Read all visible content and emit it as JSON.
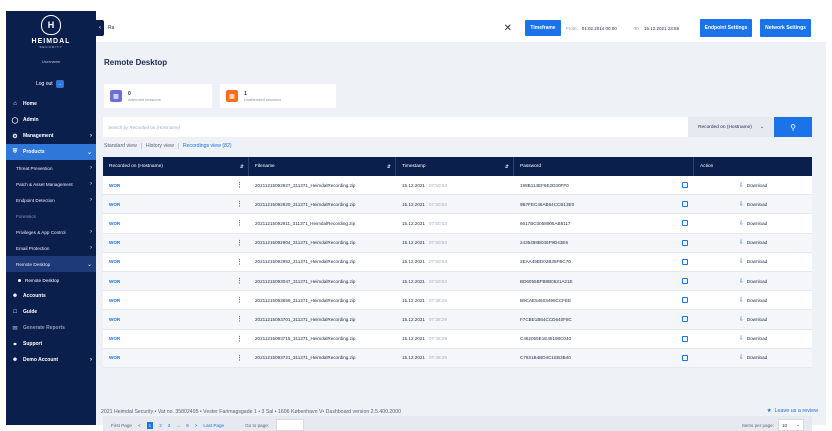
{
  "brand": {
    "name": "HEIMDAL",
    "tagline": "SECURITY",
    "user": "Username"
  },
  "logout": {
    "label": "Log out"
  },
  "sidebar": {
    "items": [
      {
        "label": "Home",
        "icon": "home-icon"
      },
      {
        "label": "Admin",
        "icon": "admin-icon"
      },
      {
        "label": "Management",
        "icon": "management-icon"
      },
      {
        "label": "Products",
        "icon": "shield-icon"
      }
    ],
    "products_sub": [
      "Threat Prevention",
      "Patch & Asset Management",
      "Endpoint Detection",
      "Forensics",
      "Privileges & App Control",
      "Email Protection",
      "Remote Desktop"
    ],
    "remote_sub": "Remote Desktop",
    "bottom_items": [
      {
        "label": "Accounts",
        "icon": "accounts-icon"
      },
      {
        "label": "Guide",
        "icon": "guide-icon"
      },
      {
        "label": "Generate Reports",
        "icon": "reports-icon"
      },
      {
        "label": "Support",
        "icon": "support-icon"
      },
      {
        "label": "Demo Account",
        "icon": "demo-account-icon"
      }
    ]
  },
  "topbar": {
    "search_value": "Ra",
    "timeframe_label": "Timeframe",
    "from_label": "From:",
    "from_value": "01.02.2014 00:00",
    "to_label": "To:",
    "to_value": "15.12.2021 23:59",
    "endpoint_settings": "Endpoint Settings",
    "network_settings": "Network Settings"
  },
  "page": {
    "title": "Remote Desktop",
    "attended": {
      "count": "0",
      "label": "Attended sessions"
    },
    "unattended": {
      "count": "1",
      "label": "Unattended sessions"
    },
    "search_placeholder": "Search by Recorded on (Hostname)",
    "filter_select": "Recorded on (Hostname)",
    "views": [
      "Standard view",
      "History view",
      "Recordings view (82)"
    ]
  },
  "table": {
    "headers": [
      "Recorded on (Hostname)",
      "Filename",
      "Timestamp",
      "Password",
      "Action"
    ],
    "rows": [
      {
        "host": "WOR",
        "file": "20211215092927_311371_HeimdalRecording.zip",
        "date": "15.12.2021",
        "time": "07:50:53",
        "pwd": "198B114EF6E2D30FF0",
        "action": "Download"
      },
      {
        "host": "WOR",
        "file": "20211215092920_311371_HeimdalRecording.zip",
        "date": "15.12.2021",
        "time": "07:50:53",
        "pwd": "9B7FEC46AB64CCB13E0",
        "action": "Download"
      },
      {
        "host": "WOR",
        "file": "20211215092911_311371_HeimdalRecording.zip",
        "date": "15.12.2021",
        "time": "07:50:53",
        "pwd": "6617BC0058905AB8117",
        "action": "Download"
      },
      {
        "host": "WOR",
        "file": "20211215092904_311371_HeimdalRecording.zip",
        "date": "15.12.2021",
        "time": "07:50:53",
        "pwd": "2435498B046F9D43E6",
        "action": "Download"
      },
      {
        "host": "WOR",
        "file": "20211215092952_311371_HeimdalRecording.zip",
        "date": "15.12.2021",
        "time": "07:50:53",
        "pwd": "2EAA49BD02B35FBC70",
        "action": "Download"
      },
      {
        "host": "WOR",
        "file": "20211215093047_311371_HeimdalRecording.zip",
        "date": "15.12.2021",
        "time": "07:50:53",
        "pwd": "BD6055BFB8B0531A21E",
        "action": "Download"
      },
      {
        "host": "WOR",
        "file": "20211215093659_311371_HeimdalRecording.zip",
        "date": "15.12.2021",
        "time": "07:38:29",
        "pwd": "B9CAE54603498CCFEE",
        "action": "Download"
      },
      {
        "host": "WOR",
        "file": "20211215093701_311371_HeimdalRecording.zip",
        "date": "15.12.2021",
        "time": "07:38:29",
        "pwd": "F7CBE1B64CCD640F8C",
        "action": "Download"
      },
      {
        "host": "WOR",
        "file": "20211215093715_311371_HeimdalRecording.zip",
        "date": "15.12.2021",
        "time": "07:38:29",
        "pwd": "C462055E1E45198C040",
        "action": "Download"
      },
      {
        "host": "WOR",
        "file": "20211215093721_311371_HeimdalRecording.zip",
        "date": "15.12.2021",
        "time": "07:38:29",
        "pwd": "C7831B4BD4C1EB3B40",
        "action": "Download"
      }
    ]
  },
  "pager": {
    "first": "First Page",
    "prev": "<",
    "pages": [
      "1",
      "2",
      "3",
      "...",
      "9"
    ],
    "next": ">",
    "last": "Last Page",
    "goto_label": "Go to page:",
    "per_page_label": "Items per page:",
    "per_page_value": "10"
  },
  "footer": {
    "text": "2021 Heimdal Security • Vat no. 35802495 • Vester Farimagsgade 1 • 3 Sal • 1606 København V• Dashboard version 2.5.400.2000",
    "review": "Leave us a review"
  },
  "colors": {
    "navy": "#0b1f4d",
    "accent": "#1a73e8",
    "orange": "#f26d1f",
    "purple": "#6b6fd4"
  }
}
